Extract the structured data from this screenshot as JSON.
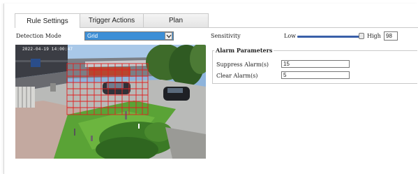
{
  "tabs": [
    {
      "label": "Rule Settings",
      "active": true
    },
    {
      "label": "Trigger Actions",
      "active": false
    },
    {
      "label": "Plan",
      "active": false
    }
  ],
  "detection": {
    "label": "Detection Mode",
    "selected": "Grid"
  },
  "sensitivity": {
    "label": "Sensitivity",
    "low_label": "Low",
    "high_label": "High",
    "value": "98"
  },
  "video": {
    "timestamp": "2022-04-19 14:00:47"
  },
  "alarm_parameters": {
    "title": "Alarm Parameters",
    "suppress_label": "Suppress Alarm(s)",
    "suppress_value": "15",
    "clear_label": "Clear Alarm(s)",
    "clear_value": "5"
  },
  "colors": {
    "select_highlight": "#3d8fd6",
    "slider_track": "#3a5fa8",
    "grid_lines": "#e02020"
  }
}
